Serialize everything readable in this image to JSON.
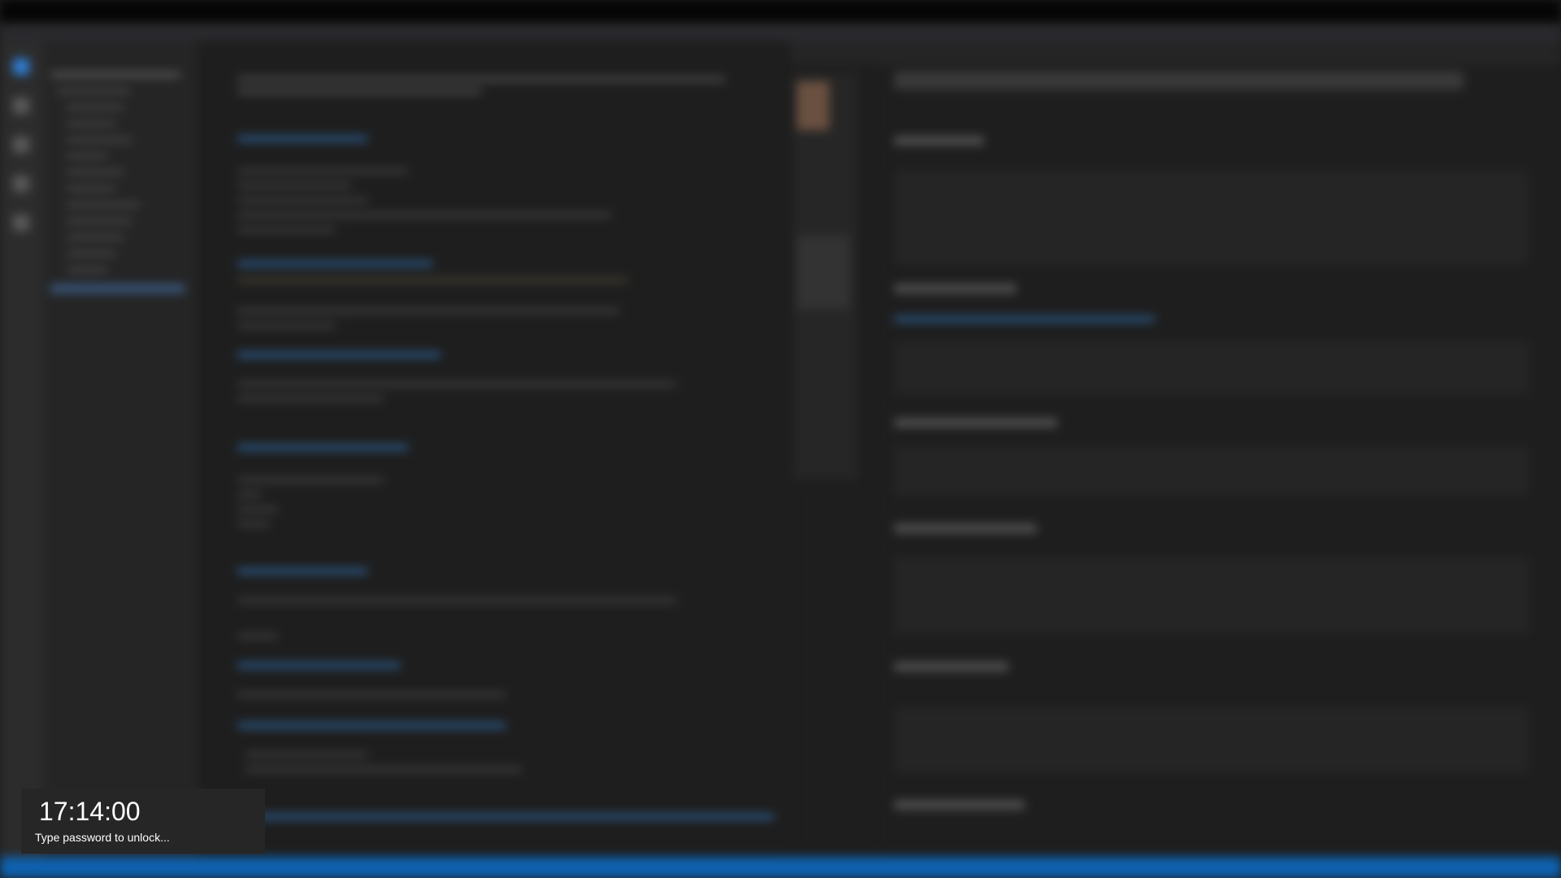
{
  "lock_screen": {
    "time": "17:14:00",
    "hint": "Type password to unlock..."
  },
  "colors": {
    "background": "#1e1e1e",
    "statusbar": "#0e62b0",
    "accent": "#3794ff",
    "lock_panel": "#262626",
    "text": "#ffffff"
  }
}
